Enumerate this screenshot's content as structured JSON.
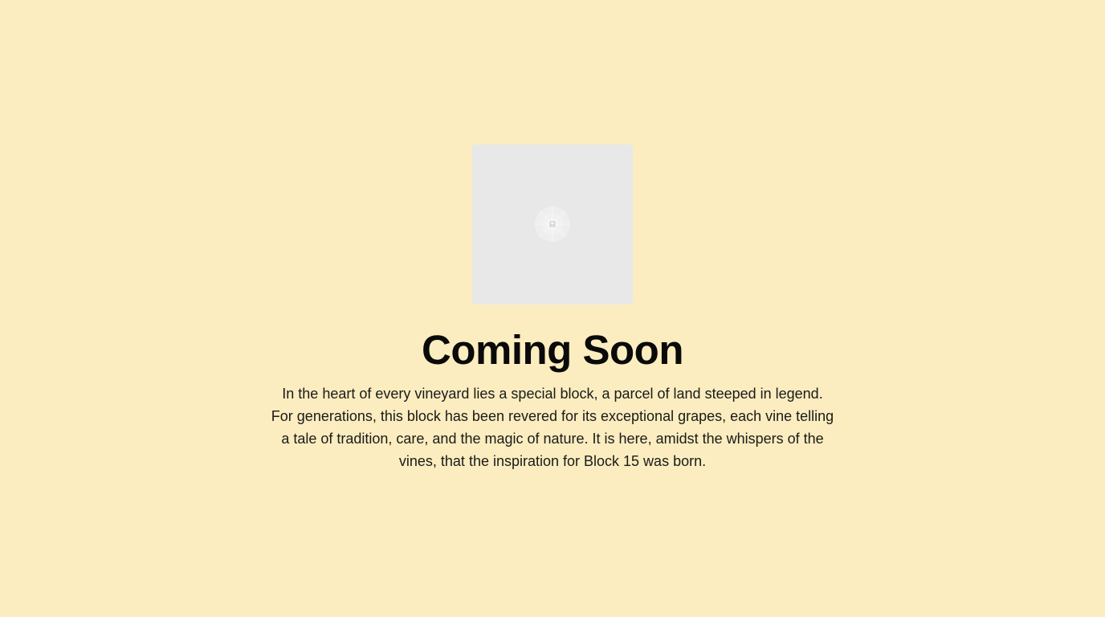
{
  "image": {
    "icon": "image-placeholder-icon"
  },
  "heading": "Coming Soon",
  "description": "In the heart of every vineyard lies a special block, a parcel of land steeped in legend. For generations, this block has been revered for its exceptional grapes, each vine telling a tale of tradition, care, and the magic of nature. It is here, amidst the whispers of the vines, that the inspiration for Block 15 was born.",
  "colors": {
    "background": "#fbedbf",
    "placeholder": "#e8e8e8",
    "heading": "#0a0a0a",
    "body_text": "#1a1a1a"
  }
}
